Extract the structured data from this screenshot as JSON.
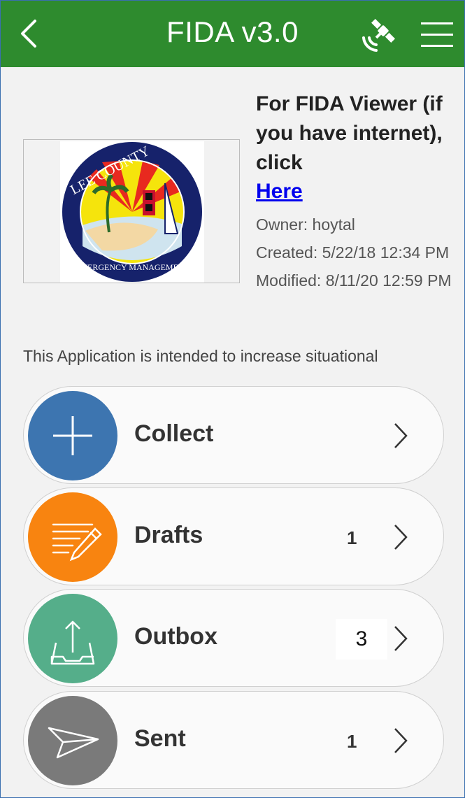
{
  "header": {
    "title": "FIDA v3.0",
    "color": "#2e8b2e"
  },
  "info": {
    "heading": "For FIDA Viewer (if you have internet), click",
    "link_text": "Here",
    "owner": "Owner: hoytal",
    "created": "Created: 5/22/18 12:34 PM",
    "modified": "Modified: 8/11/20 12:59 PM"
  },
  "logo": {
    "text_top": "LEE COUNTY",
    "text_bottom": "EMERGENCY MANAGEMENT"
  },
  "description": "This Application is intended to increase situational",
  "actions": [
    {
      "label": "Collect",
      "count": "",
      "icon": "plus-icon",
      "color": "#3d75b0"
    },
    {
      "label": "Drafts",
      "count": "1",
      "icon": "edit-list-icon",
      "color": "#f88410"
    },
    {
      "label": "Outbox",
      "count": "3",
      "icon": "outbox-upload-icon",
      "color": "#55ae8a"
    },
    {
      "label": "Sent",
      "count": "1",
      "icon": "paper-plane-icon",
      "color": "#7a7a7a"
    }
  ]
}
